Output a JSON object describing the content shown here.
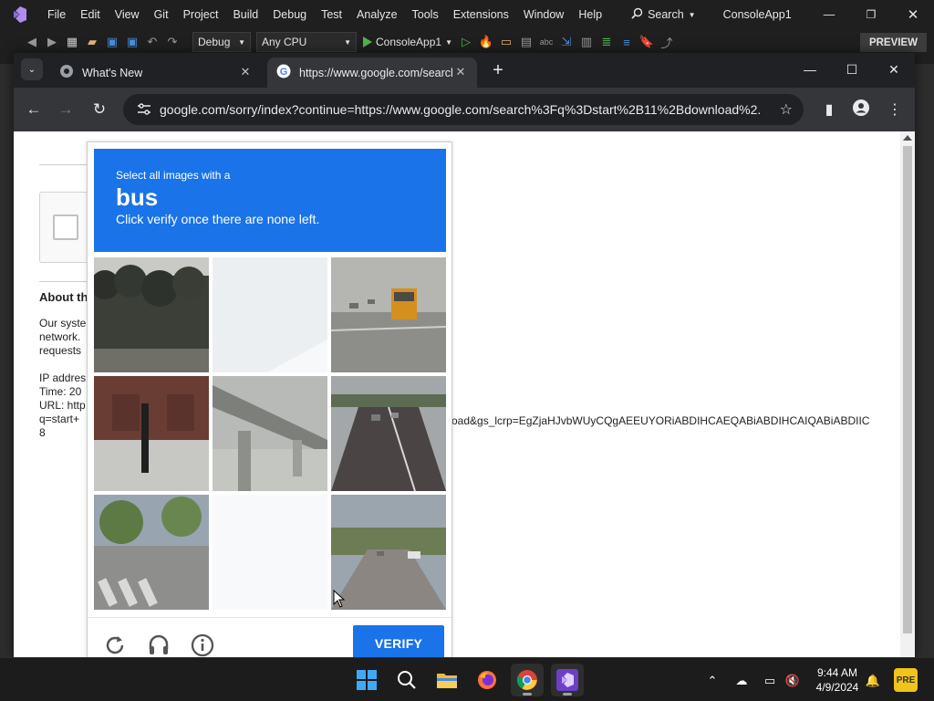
{
  "vs": {
    "menu": [
      "File",
      "Edit",
      "View",
      "Git",
      "Project",
      "Build",
      "Debug",
      "Test",
      "Analyze",
      "Tools",
      "Extensions",
      "Window",
      "Help"
    ],
    "search_label": "Search",
    "solution_name": "ConsoleApp1",
    "toolbar": {
      "config": "Debug",
      "platform": "Any CPU",
      "run_target": "ConsoleApp1",
      "preview_label": "PREVIEW"
    }
  },
  "chrome": {
    "tabs": [
      {
        "title": "What's New",
        "active": false
      },
      {
        "title": "https://www.google.com/search",
        "active": true
      }
    ],
    "url": "google.com/sorry/index?continue=https://www.google.com/search%3Fq%3Dstart%2B11%2Bdownload%2..."
  },
  "page": {
    "about_title": "About th",
    "para_lines": [
      "Our syste",
      "network.",
      "requests"
    ],
    "info_lines": [
      "IP addres",
      "Time: 20",
      "URL: http",
      "q=start+",
      "8"
    ],
    "url_tail": "oad&gs_lcrp=EgZjaHJvbWUyCQgAEEUYORiABDIHCAEQABiABDIHCAIQABiABDIIC"
  },
  "captcha": {
    "line1": "Select all images with a",
    "target": "bus",
    "line3": "Click verify once there are none left.",
    "tiles": [
      {
        "subject": "trees"
      },
      {
        "subject": "blank-fading"
      },
      {
        "subject": "school-bus-on-road"
      },
      {
        "subject": "bollard-and-snow"
      },
      {
        "subject": "bridge-underpass"
      },
      {
        "subject": "highway-traffic"
      },
      {
        "subject": "crosswalk-street"
      },
      {
        "subject": "blank-fading"
      },
      {
        "subject": "road-with-cars"
      }
    ],
    "verify_label": "VERIFY",
    "icons": [
      "reload-icon",
      "audio-icon",
      "info-icon"
    ]
  },
  "taskbar": {
    "apps": [
      "windows-start",
      "search",
      "file-explorer",
      "firefox",
      "chrome",
      "visual-studio"
    ],
    "time": "9:44 AM",
    "date": "4/9/2024"
  },
  "colors": {
    "captcha_blue": "#1a73e8",
    "vs_bg": "#1f1f1f",
    "chrome_dark": "#202124"
  }
}
